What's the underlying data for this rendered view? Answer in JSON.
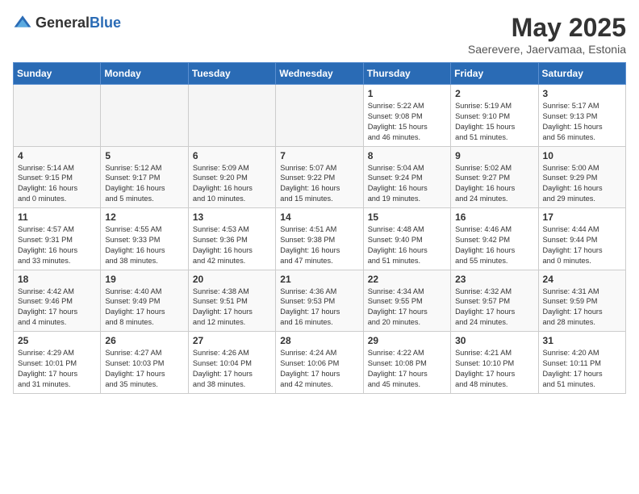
{
  "header": {
    "logo_general": "General",
    "logo_blue": "Blue",
    "title": "May 2025",
    "subtitle": "Saerevere, Jaervamaa, Estonia"
  },
  "weekdays": [
    "Sunday",
    "Monday",
    "Tuesday",
    "Wednesday",
    "Thursday",
    "Friday",
    "Saturday"
  ],
  "weeks": [
    [
      {
        "day": "",
        "info": ""
      },
      {
        "day": "",
        "info": ""
      },
      {
        "day": "",
        "info": ""
      },
      {
        "day": "",
        "info": ""
      },
      {
        "day": "1",
        "info": "Sunrise: 5:22 AM\nSunset: 9:08 PM\nDaylight: 15 hours\nand 46 minutes."
      },
      {
        "day": "2",
        "info": "Sunrise: 5:19 AM\nSunset: 9:10 PM\nDaylight: 15 hours\nand 51 minutes."
      },
      {
        "day": "3",
        "info": "Sunrise: 5:17 AM\nSunset: 9:13 PM\nDaylight: 15 hours\nand 56 minutes."
      }
    ],
    [
      {
        "day": "4",
        "info": "Sunrise: 5:14 AM\nSunset: 9:15 PM\nDaylight: 16 hours\nand 0 minutes."
      },
      {
        "day": "5",
        "info": "Sunrise: 5:12 AM\nSunset: 9:17 PM\nDaylight: 16 hours\nand 5 minutes."
      },
      {
        "day": "6",
        "info": "Sunrise: 5:09 AM\nSunset: 9:20 PM\nDaylight: 16 hours\nand 10 minutes."
      },
      {
        "day": "7",
        "info": "Sunrise: 5:07 AM\nSunset: 9:22 PM\nDaylight: 16 hours\nand 15 minutes."
      },
      {
        "day": "8",
        "info": "Sunrise: 5:04 AM\nSunset: 9:24 PM\nDaylight: 16 hours\nand 19 minutes."
      },
      {
        "day": "9",
        "info": "Sunrise: 5:02 AM\nSunset: 9:27 PM\nDaylight: 16 hours\nand 24 minutes."
      },
      {
        "day": "10",
        "info": "Sunrise: 5:00 AM\nSunset: 9:29 PM\nDaylight: 16 hours\nand 29 minutes."
      }
    ],
    [
      {
        "day": "11",
        "info": "Sunrise: 4:57 AM\nSunset: 9:31 PM\nDaylight: 16 hours\nand 33 minutes."
      },
      {
        "day": "12",
        "info": "Sunrise: 4:55 AM\nSunset: 9:33 PM\nDaylight: 16 hours\nand 38 minutes."
      },
      {
        "day": "13",
        "info": "Sunrise: 4:53 AM\nSunset: 9:36 PM\nDaylight: 16 hours\nand 42 minutes."
      },
      {
        "day": "14",
        "info": "Sunrise: 4:51 AM\nSunset: 9:38 PM\nDaylight: 16 hours\nand 47 minutes."
      },
      {
        "day": "15",
        "info": "Sunrise: 4:48 AM\nSunset: 9:40 PM\nDaylight: 16 hours\nand 51 minutes."
      },
      {
        "day": "16",
        "info": "Sunrise: 4:46 AM\nSunset: 9:42 PM\nDaylight: 16 hours\nand 55 minutes."
      },
      {
        "day": "17",
        "info": "Sunrise: 4:44 AM\nSunset: 9:44 PM\nDaylight: 17 hours\nand 0 minutes."
      }
    ],
    [
      {
        "day": "18",
        "info": "Sunrise: 4:42 AM\nSunset: 9:46 PM\nDaylight: 17 hours\nand 4 minutes."
      },
      {
        "day": "19",
        "info": "Sunrise: 4:40 AM\nSunset: 9:49 PM\nDaylight: 17 hours\nand 8 minutes."
      },
      {
        "day": "20",
        "info": "Sunrise: 4:38 AM\nSunset: 9:51 PM\nDaylight: 17 hours\nand 12 minutes."
      },
      {
        "day": "21",
        "info": "Sunrise: 4:36 AM\nSunset: 9:53 PM\nDaylight: 17 hours\nand 16 minutes."
      },
      {
        "day": "22",
        "info": "Sunrise: 4:34 AM\nSunset: 9:55 PM\nDaylight: 17 hours\nand 20 minutes."
      },
      {
        "day": "23",
        "info": "Sunrise: 4:32 AM\nSunset: 9:57 PM\nDaylight: 17 hours\nand 24 minutes."
      },
      {
        "day": "24",
        "info": "Sunrise: 4:31 AM\nSunset: 9:59 PM\nDaylight: 17 hours\nand 28 minutes."
      }
    ],
    [
      {
        "day": "25",
        "info": "Sunrise: 4:29 AM\nSunset: 10:01 PM\nDaylight: 17 hours\nand 31 minutes."
      },
      {
        "day": "26",
        "info": "Sunrise: 4:27 AM\nSunset: 10:03 PM\nDaylight: 17 hours\nand 35 minutes."
      },
      {
        "day": "27",
        "info": "Sunrise: 4:26 AM\nSunset: 10:04 PM\nDaylight: 17 hours\nand 38 minutes."
      },
      {
        "day": "28",
        "info": "Sunrise: 4:24 AM\nSunset: 10:06 PM\nDaylight: 17 hours\nand 42 minutes."
      },
      {
        "day": "29",
        "info": "Sunrise: 4:22 AM\nSunset: 10:08 PM\nDaylight: 17 hours\nand 45 minutes."
      },
      {
        "day": "30",
        "info": "Sunrise: 4:21 AM\nSunset: 10:10 PM\nDaylight: 17 hours\nand 48 minutes."
      },
      {
        "day": "31",
        "info": "Sunrise: 4:20 AM\nSunset: 10:11 PM\nDaylight: 17 hours\nand 51 minutes."
      }
    ]
  ]
}
